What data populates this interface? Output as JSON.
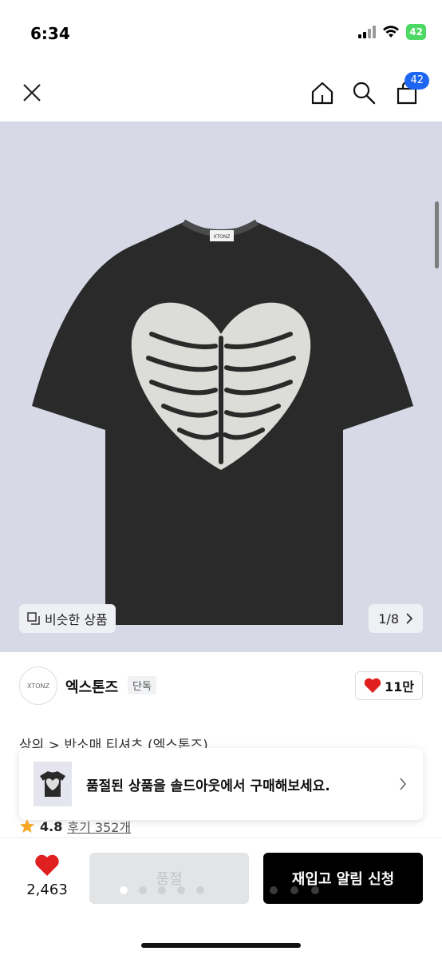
{
  "status_bar": {
    "time": "6:34",
    "battery": "42"
  },
  "nav": {
    "cart_badge": "42"
  },
  "gallery": {
    "similar_label": "비슷한 상품",
    "counter": "1/8",
    "tshirt_label": "XTONZ"
  },
  "brand": {
    "name": "엑스톤즈",
    "tag": "단독",
    "likes": "11만",
    "logo_text": "XTONZ"
  },
  "breadcrumb": "상의 > 반소매 티셔츠 (엑스톤즈)",
  "soldout_banner": {
    "text": "품절된 상품을 솔드아웃에서 구매해보세요."
  },
  "rating": {
    "score": "4.8",
    "reviews": "후기 352개"
  },
  "bottom_bar": {
    "wish_count": "2,463",
    "soldout_label": "품절",
    "restock_label": "재입고 알림 신청"
  },
  "colors": {
    "hero_bg": "#d8d9e7",
    "badge": "#1d66f2",
    "heart": "#e02020",
    "star": "#f5a623"
  }
}
